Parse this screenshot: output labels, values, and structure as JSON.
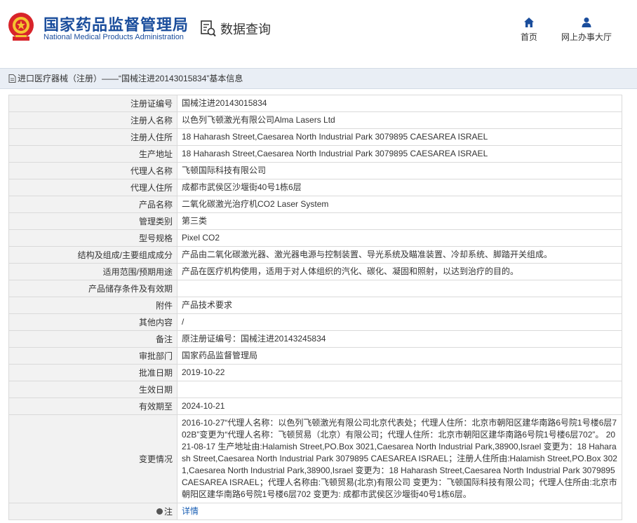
{
  "header": {
    "org_name_cn": "国家药品监督管理局",
    "org_name_en": "National Medical Products Administration",
    "query_title": "数据查询",
    "nav": [
      {
        "label": "首页",
        "icon": "home-icon"
      },
      {
        "label": "网上办事大厅",
        "icon": "user-icon"
      }
    ]
  },
  "breadcrumb": {
    "text": "进口医疗器械（注册）——“国械注进20143015834”基本信息"
  },
  "colors": {
    "brand_blue": "#1a4d9c",
    "label_bg": "#f2f2f2",
    "border": "#dadada",
    "crumb_bg": "#e9eef5",
    "link": "#1a5fb4"
  },
  "rows": [
    {
      "label": "注册证编号",
      "value": "国械注进20143015834"
    },
    {
      "label": "注册人名称",
      "value": "以色列飞顿激光有限公司Alma Lasers Ltd"
    },
    {
      "label": "注册人住所",
      "value": "18 Haharash Street,Caesarea North Industrial Park 3079895 CAESAREA ISRAEL"
    },
    {
      "label": "生产地址",
      "value": "18 Haharash Street,Caesarea North Industrial Park 3079895 CAESAREA ISRAEL"
    },
    {
      "label": "代理人名称",
      "value": "飞顿国际科技有限公司"
    },
    {
      "label": "代理人住所",
      "value": "成都市武侯区沙堰街40号1栋6层"
    },
    {
      "label": "产品名称",
      "value": "二氧化碳激光治疗机CO2 Laser System"
    },
    {
      "label": "管理类别",
      "value": "第三类"
    },
    {
      "label": "型号规格",
      "value": "Pixel CO2"
    },
    {
      "label": "结构及组成/主要组成成分",
      "value": "产品由二氧化碳激光器、激光器电源与控制装置、导光系统及瞄准装置、冷却系统、脚踏开关组成。"
    },
    {
      "label": "适用范围/预期用途",
      "value": "产品在医疗机构使用，适用于对人体组织的汽化、碳化、凝固和照射，以达到治疗的目的。"
    },
    {
      "label": "产品储存条件及有效期",
      "value": ""
    },
    {
      "label": "附件",
      "value": "产品技术要求"
    },
    {
      "label": "其他内容",
      "value": "/"
    },
    {
      "label": "备注",
      "value": "原注册证编号：国械注进20143245834"
    },
    {
      "label": "审批部门",
      "value": "国家药品监督管理局"
    },
    {
      "label": "批准日期",
      "value": "2019-10-22"
    },
    {
      "label": "生效日期",
      "value": ""
    },
    {
      "label": "有效期至",
      "value": "2024-10-21"
    },
    {
      "label": "变更情况",
      "value": "2016-10-27“代理人名称：以色列飞顿激光有限公司北京代表处；代理人住所：北京市朝阳区建华南路6号院1号楼6层702B”变更为“代理人名称：飞顿贸易（北京）有限公司；代理人住所：北京市朝阳区建华南路6号院1号楼6层702”。 2021-08-17 生产地址由:Halamish Street,PO.Box 3021,Caesarea North Industrial Park,38900,Israel 变更为：18 Haharash Street,Caesarea North Industrial Park 3079895 CAESAREA ISRAEL；注册人住所由:Halamish Street,PO.Box 3021,Caesarea North Industrial Park,38900,Israel 变更为：18 Haharash Street,Caesarea North Industrial Park 3079895 CAESAREA ISRAEL；代理人名称由:飞顿贸易(北京)有限公司 变更为：飞顿国际科技有限公司；代理人住所由:北京市朝阳区建华南路6号院1号楼6层702 变更为: 成都市武侯区沙堰街40号1栋6层。"
    }
  ],
  "footer_row": {
    "label": "注",
    "link": "详情"
  }
}
